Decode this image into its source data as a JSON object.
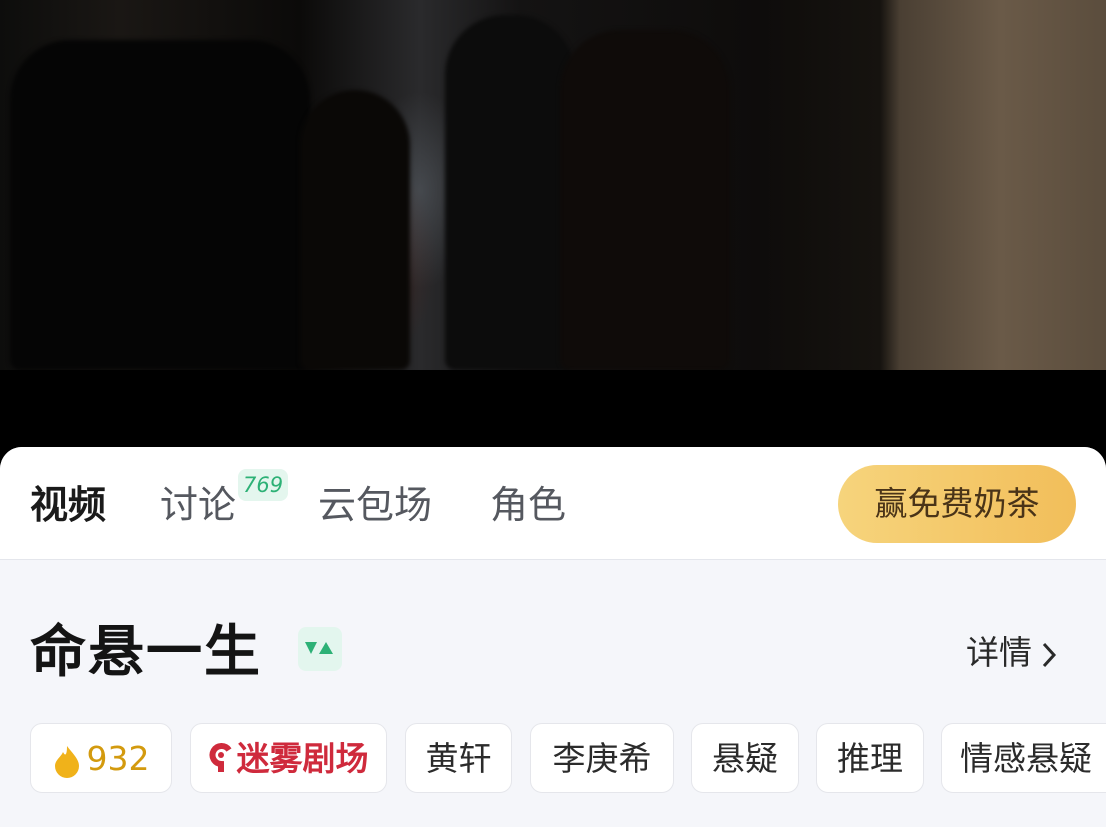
{
  "video": {
    "description_icon": "video-frame"
  },
  "tabs": [
    {
      "label": "视频",
      "active": true
    },
    {
      "label": "讨论",
      "badge": "769"
    },
    {
      "label": "云包场"
    },
    {
      "label": "角色"
    }
  ],
  "promo_button": "赢免费奶茶",
  "show": {
    "title": "命悬一生",
    "badge_icon": "vip-badge-icon",
    "details_label": "详情"
  },
  "chips": {
    "score": "932",
    "brand": "迷雾剧场",
    "actor1": "黄轩",
    "actor2": "李庚希",
    "tag1": "悬疑",
    "tag2": "推理",
    "tag3": "情感悬疑"
  },
  "colors": {
    "accent_green": "#2db176",
    "promo_gold": "#f2be5a",
    "brand_red": "#cf2a3c",
    "score_gold": "#f0b21a"
  }
}
